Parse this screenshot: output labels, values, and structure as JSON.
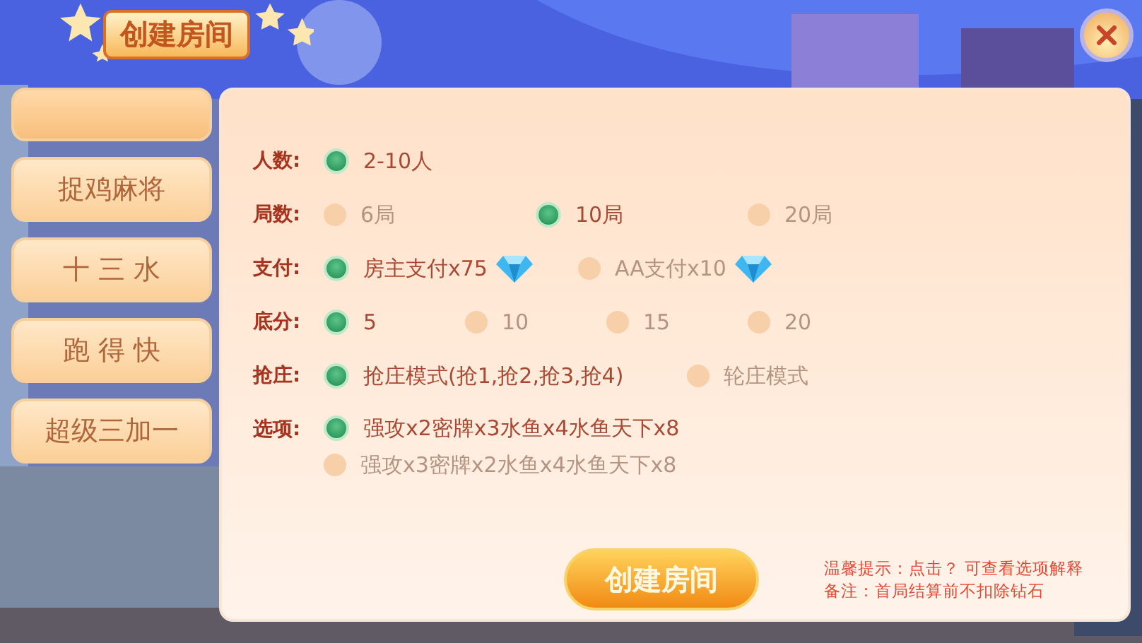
{
  "header": {
    "title": "创建房间"
  },
  "tabs": [
    {
      "selected": true
    },
    {
      "label": "捉鸡麻将",
      "selected": false
    },
    {
      "label": "十 三 水",
      "selected": false
    },
    {
      "label": "跑 得 快",
      "selected": false
    },
    {
      "label": "超级三加一",
      "selected": false
    }
  ],
  "settings": [
    {
      "label": "人数:",
      "kind": "inline",
      "options": [
        {
          "text": "2-10人",
          "selected": true
        }
      ]
    },
    {
      "label": "局数:",
      "kind": "inline",
      "options": [
        {
          "text": "6局",
          "selected": false
        },
        {
          "text": "10局",
          "selected": true
        },
        {
          "text": "20局",
          "selected": false
        }
      ]
    },
    {
      "label": "支付:",
      "kind": "inline",
      "options": [
        {
          "text": "房主支付x75",
          "selected": true,
          "currency_icon": true
        },
        {
          "text": "AA支付x10",
          "selected": false,
          "currency_icon": true
        }
      ]
    },
    {
      "label": "底分:",
      "kind": "inline",
      "options": [
        {
          "text": "5",
          "selected": true
        },
        {
          "text": "10",
          "selected": false
        },
        {
          "text": "15",
          "selected": false
        },
        {
          "text": "20",
          "selected": false
        }
      ]
    },
    {
      "label": "抢庄:",
      "kind": "inline",
      "options": [
        {
          "text": "抢庄模式(抢1,抢2,抢3,抢4)",
          "selected": true
        },
        {
          "text": "轮庄模式",
          "selected": false
        }
      ]
    },
    {
      "label": "选项:",
      "kind": "stacked",
      "options": [
        {
          "text": "强攻x2密牌x3水鱼x4水鱼天下x8",
          "selected": true
        },
        {
          "text": "强攻x3密牌x2水鱼x4水鱼天下x8",
          "selected": false
        }
      ]
    }
  ],
  "create_button": "创建房间",
  "tips": [
    "温馨提示：点击？ 可查看选项解释",
    "备注：首局结算前不扣除钻石"
  ]
}
